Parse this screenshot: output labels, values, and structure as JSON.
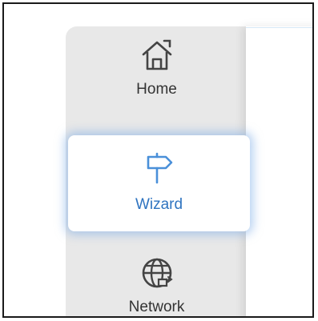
{
  "sidebar": {
    "items": [
      {
        "label": "Home",
        "icon": "home-icon",
        "active": false
      },
      {
        "label": "Wizard",
        "icon": "signpost-icon",
        "active": true
      },
      {
        "label": "Network",
        "icon": "globe-network-icon",
        "active": false
      }
    ]
  },
  "colors": {
    "active_label": "#2f74c0",
    "active_icon": "#4a90d9",
    "inactive_text": "#333333",
    "sidebar_bg": "#e8e8e8",
    "active_glow": "#78aae6"
  }
}
